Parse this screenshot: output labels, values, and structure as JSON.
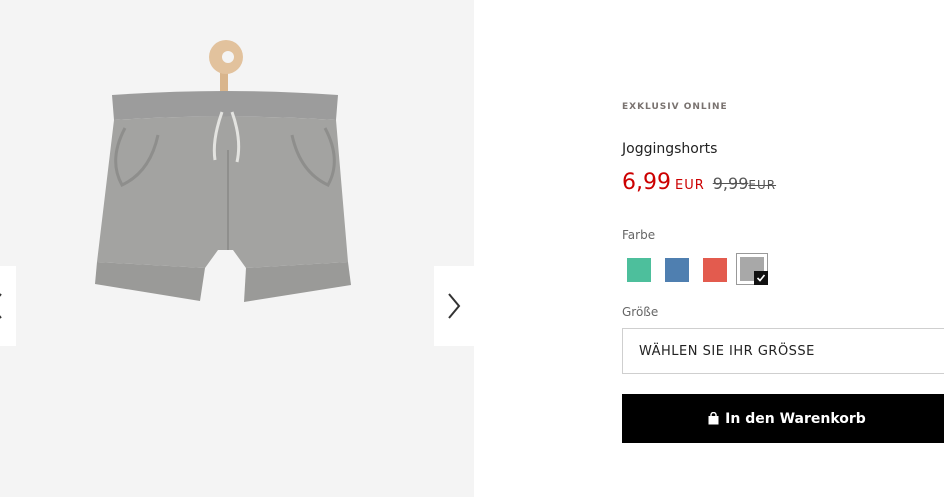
{
  "gallery": {
    "image_alt": "Joggingshorts",
    "prev_icon": "chevron-left-icon",
    "next_icon": "chevron-right-icon"
  },
  "product": {
    "badge": "EXKLUSIV ONLINE",
    "title": "Joggingshorts",
    "price": "6,99",
    "price_currency": "EUR",
    "old_price": "9,99",
    "old_price_currency": "EUR"
  },
  "color": {
    "label": "Farbe",
    "swatches": [
      {
        "name": "mint",
        "hex": "#4dbf9c"
      },
      {
        "name": "blue",
        "hex": "#4f7fb0"
      },
      {
        "name": "coral",
        "hex": "#e35b4e"
      },
      {
        "name": "grey",
        "hex": "#a8a8a8",
        "selected": true
      }
    ]
  },
  "size": {
    "label": "Größe",
    "placeholder": "WÄHLEN SIE IHR GRÖSSE"
  },
  "cart": {
    "label": "In den Warenkorb",
    "icon": "shopping-bag-icon"
  }
}
